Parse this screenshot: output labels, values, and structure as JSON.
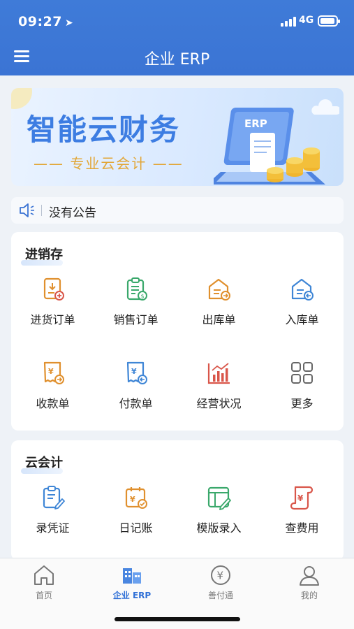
{
  "status": {
    "time": "09:27",
    "network": "4G"
  },
  "header": {
    "title": "企业 ERP"
  },
  "banner": {
    "title": "智能云财务",
    "subtitle": "—— 专业云会计 ——",
    "badge": "ERP"
  },
  "notice": {
    "text": "没有公告"
  },
  "inventory": {
    "title": "进销存",
    "items": [
      {
        "label": "进货订单",
        "icon": "purchase-order-icon"
      },
      {
        "label": "销售订单",
        "icon": "sales-order-icon"
      },
      {
        "label": "出库单",
        "icon": "outbound-icon"
      },
      {
        "label": "入库单",
        "icon": "inbound-icon"
      },
      {
        "label": "收款单",
        "icon": "receipt-icon"
      },
      {
        "label": "付款单",
        "icon": "payment-icon"
      },
      {
        "label": "经营状况",
        "icon": "chart-icon"
      },
      {
        "label": "更多",
        "icon": "grid-icon"
      }
    ]
  },
  "accounting": {
    "title": "云会计",
    "items": [
      {
        "label": "录凭证",
        "icon": "voucher-icon"
      },
      {
        "label": "日记账",
        "icon": "journal-icon"
      },
      {
        "label": "模版录入",
        "icon": "template-icon"
      },
      {
        "label": "查费用",
        "icon": "expense-icon"
      }
    ]
  },
  "tabbar": {
    "tabs": [
      {
        "label": "首页",
        "icon": "home-icon"
      },
      {
        "label": "企业 ERP",
        "icon": "building-icon"
      },
      {
        "label": "善付通",
        "icon": "yen-icon"
      },
      {
        "label": "我的",
        "icon": "user-icon"
      }
    ]
  },
  "colors": {
    "primary": "#3b74d4",
    "orange": "#e0902e",
    "green": "#3aa86b",
    "red": "#d9564a",
    "blue": "#3f86d6"
  }
}
